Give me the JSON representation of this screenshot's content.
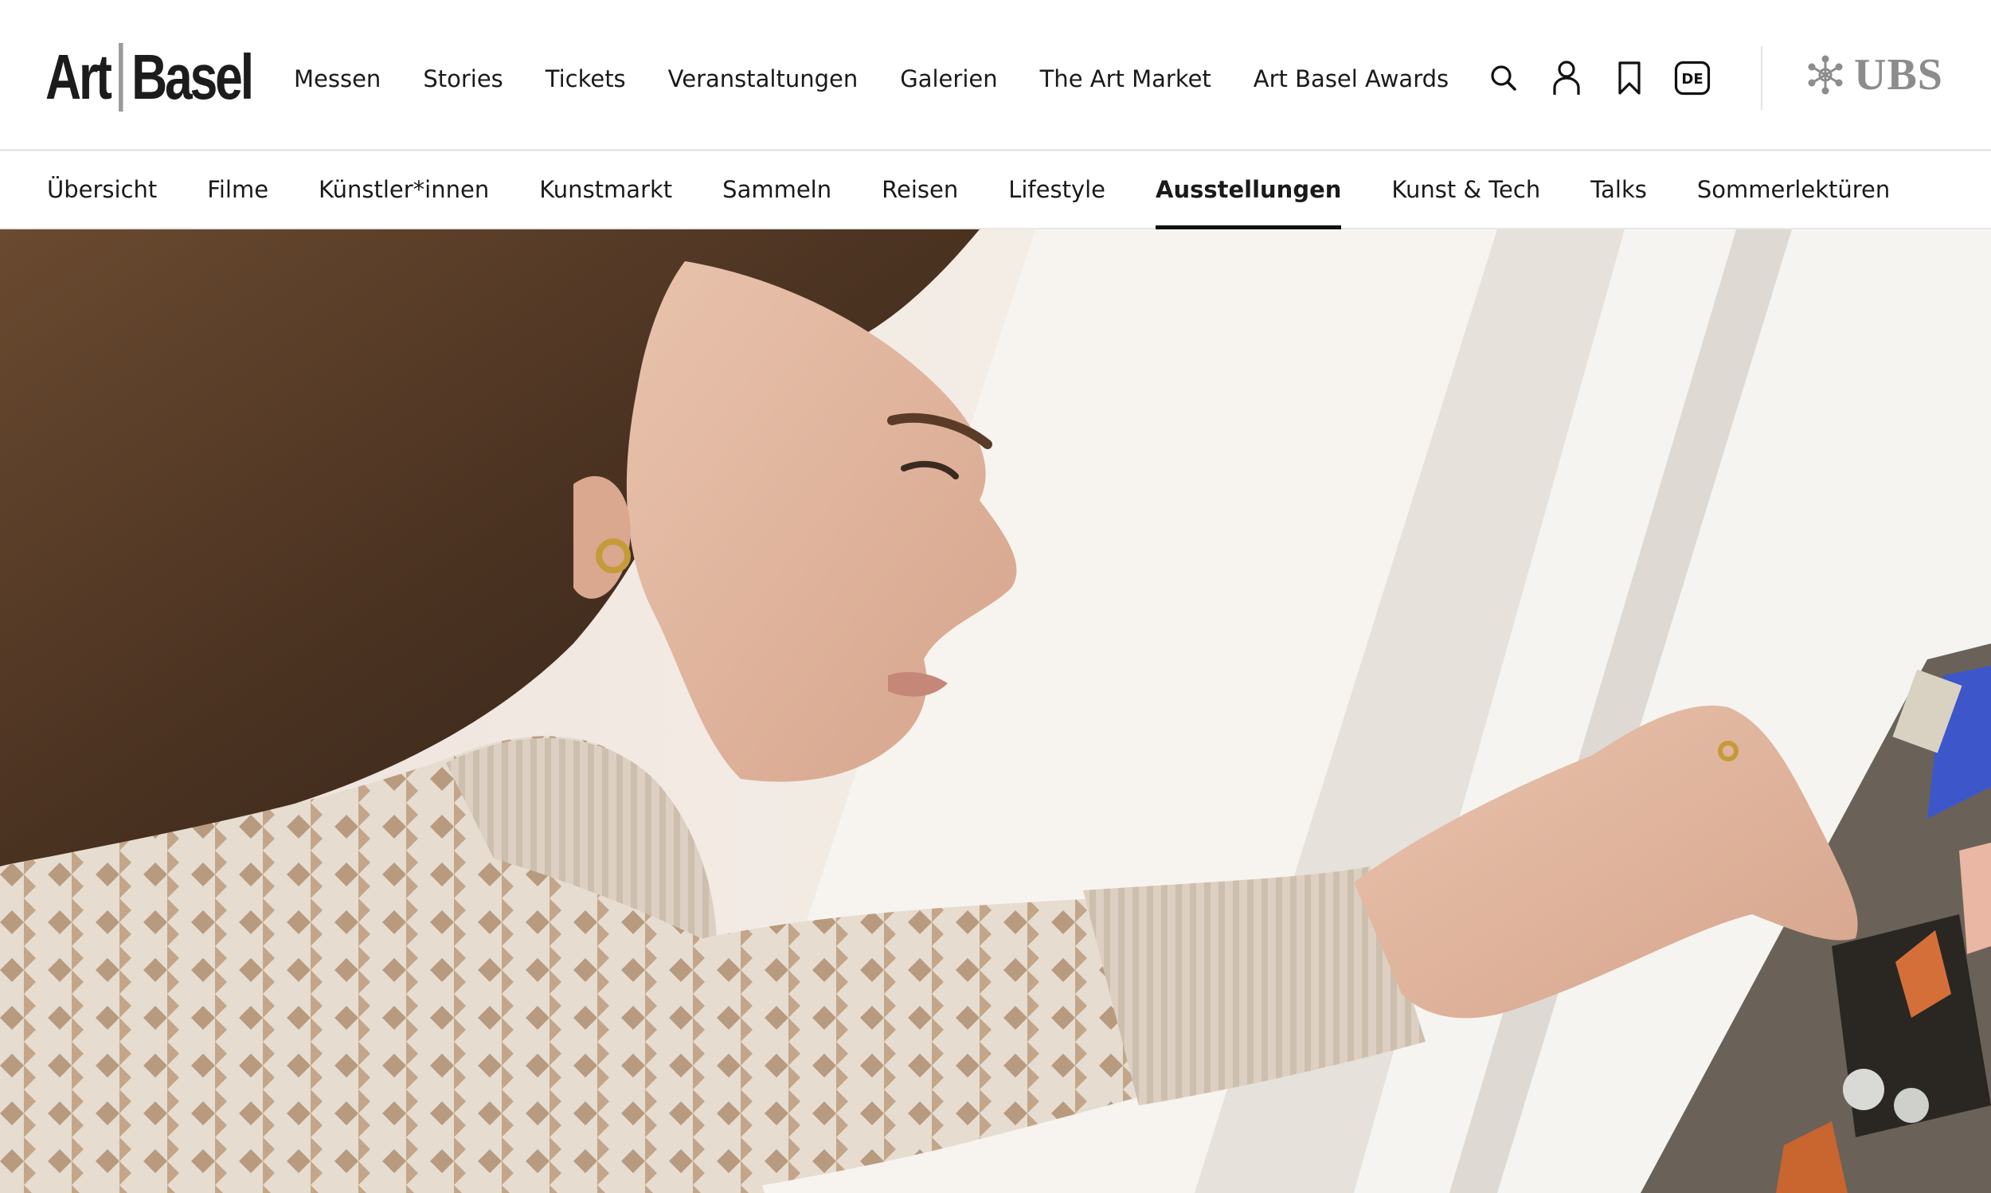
{
  "header": {
    "logo": {
      "part1": "Art",
      "part2": "Basel"
    },
    "nav": [
      {
        "label": "Messen"
      },
      {
        "label": "Stories"
      },
      {
        "label": "Tickets"
      },
      {
        "label": "Veranstaltungen"
      },
      {
        "label": "Galerien"
      },
      {
        "label": "The Art Market"
      },
      {
        "label": "Art Basel Awards"
      }
    ],
    "tools": {
      "search_icon": "search-icon",
      "account_icon": "user-icon",
      "bookmark_icon": "bookmark-icon",
      "language": "DE"
    },
    "partner": {
      "name": "UBS",
      "icon": "ubs-keys-icon"
    }
  },
  "subnav": {
    "active": "Ausstellungen",
    "items": [
      {
        "label": "Übersicht"
      },
      {
        "label": "Filme"
      },
      {
        "label": "Künstler*innen"
      },
      {
        "label": "Kunstmarkt"
      },
      {
        "label": "Sammeln"
      },
      {
        "label": "Reisen"
      },
      {
        "label": "Lifestyle"
      },
      {
        "label": "Ausstellungen"
      },
      {
        "label": "Kunst & Tech"
      },
      {
        "label": "Talks"
      },
      {
        "label": "Sommerlektüren"
      }
    ]
  },
  "hero": {
    "image": "artist-hanging-collage-photo"
  },
  "colors": {
    "text": "#111111",
    "active_underline": "#111111",
    "divider": "#e6e6e6",
    "partner_logo": "#8c8c8c"
  }
}
